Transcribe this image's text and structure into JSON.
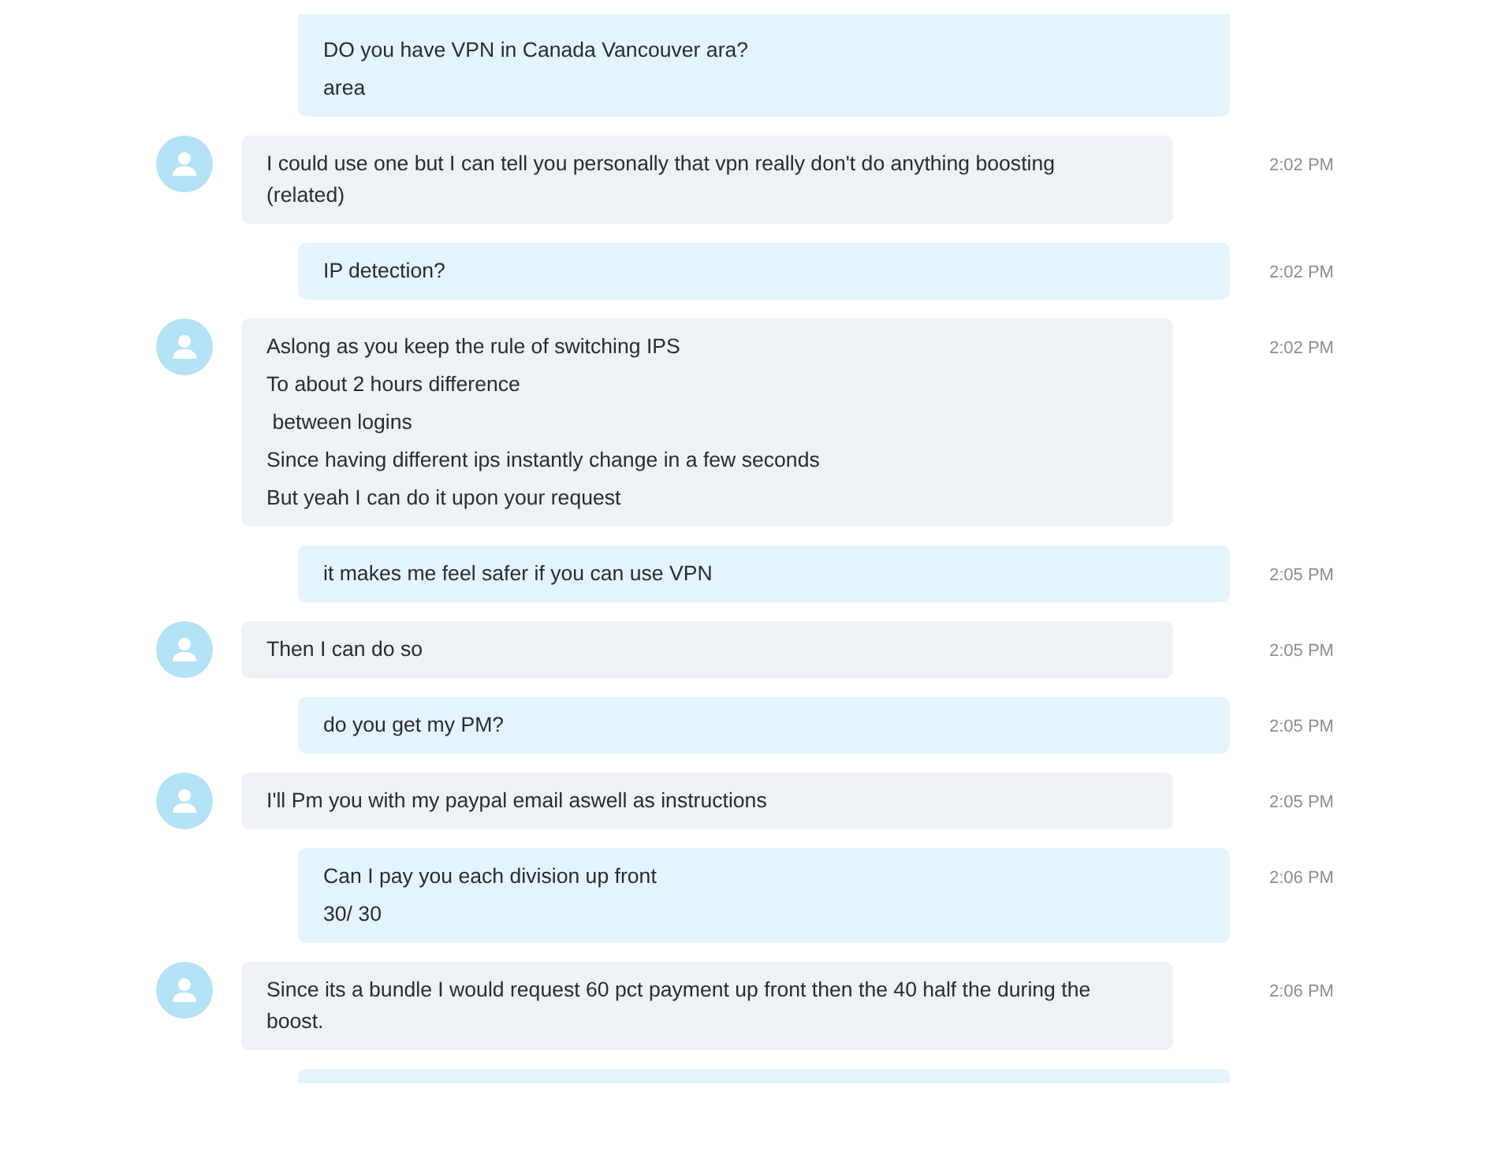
{
  "messages": [
    {
      "kind": "outgoing",
      "lines": [
        "DO you have VPN in Canada Vancouver ara?",
        "area"
      ]
    },
    {
      "kind": "incoming",
      "lines": [
        "I could use one but I can tell you personally that vpn really don't do anything boosting (related)"
      ],
      "time": "2:02 PM"
    },
    {
      "kind": "outgoing",
      "lines": [
        "IP detection?"
      ],
      "time": "2:02 PM"
    },
    {
      "kind": "incoming",
      "lines": [
        "Aslong as you keep the rule of switching IPS",
        "To about 2 hours difference",
        " between logins",
        "Since having different ips instantly change in a few seconds",
        "But yeah I can do it upon your request"
      ],
      "time": "2:02 PM"
    },
    {
      "kind": "outgoing",
      "lines": [
        "it makes me feel safer if you can use VPN"
      ],
      "time": "2:05 PM"
    },
    {
      "kind": "incoming",
      "lines": [
        "Then I can do so"
      ],
      "time": "2:05 PM"
    },
    {
      "kind": "outgoing",
      "lines": [
        "do you get my PM?"
      ],
      "time": "2:05 PM"
    },
    {
      "kind": "incoming",
      "lines": [
        "I'll Pm you with my paypal email aswell as instructions"
      ],
      "time": "2:05 PM"
    },
    {
      "kind": "outgoing",
      "lines": [
        "Can I pay you each division up front",
        "30/ 30"
      ],
      "time": "2:06 PM"
    },
    {
      "kind": "incoming",
      "lines": [
        "Since its a bundle I would request 60 pct payment up front then the 40 half the during the boost."
      ],
      "time": "2:06 PM"
    },
    {
      "kind": "outgoing"
    }
  ]
}
